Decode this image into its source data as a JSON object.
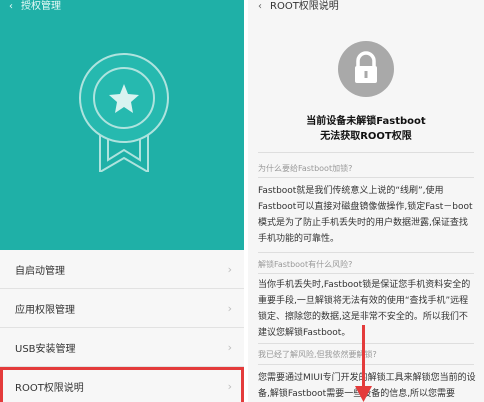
{
  "left": {
    "back_glyph": "‹",
    "title": "授权管理",
    "badge_icon": "award-star-icon",
    "items": [
      {
        "label": "自启动管理",
        "icon": "chevron-right-icon"
      },
      {
        "label": "应用权限管理",
        "icon": "chevron-right-icon"
      },
      {
        "label": "USB安装管理",
        "icon": "chevron-right-icon"
      },
      {
        "label": "ROOT权限说明",
        "icon": "chevron-right-icon"
      }
    ],
    "highlight_color": "#e43b3b",
    "accent": "#1fb0a7"
  },
  "right": {
    "back_glyph": "‹",
    "title": "ROOT权限说明",
    "lock_icon": "lock-icon",
    "status_line1": "当前设备未解锁Fastboot",
    "status_line2": "无法获取ROOT权限",
    "sections": [
      {
        "question": "为什么要给Fastboot加锁?",
        "answer": "Fastboot就是我们传统意义上说的“线刷”,使用Fastboot可以直接对磁盘镜像做操作,锁定Fast－boot模式是为了防止手机丢失时的用户数据泄露,保证查找手机功能的可靠性。"
      },
      {
        "question": "解锁Fastboot有什么风险?",
        "answer": "当你手机丢失时,Fastboot锁是保证您手机资料安全的重要手段,一旦解锁将无法有效的使用“查找手机”远程锁定、擦除您的数据,这是非常不安全的。所以我们不建议您解锁Fastboot。"
      },
      {
        "question": "我已经了解风险,但我依然要解锁?",
        "answer": "您需要通过MIUI专门开发的解锁工具来解锁您当前的设备,解锁Fastboot需要一些设备的信息,所以您需要"
      }
    ],
    "arrow_color": "#e43b3b"
  }
}
